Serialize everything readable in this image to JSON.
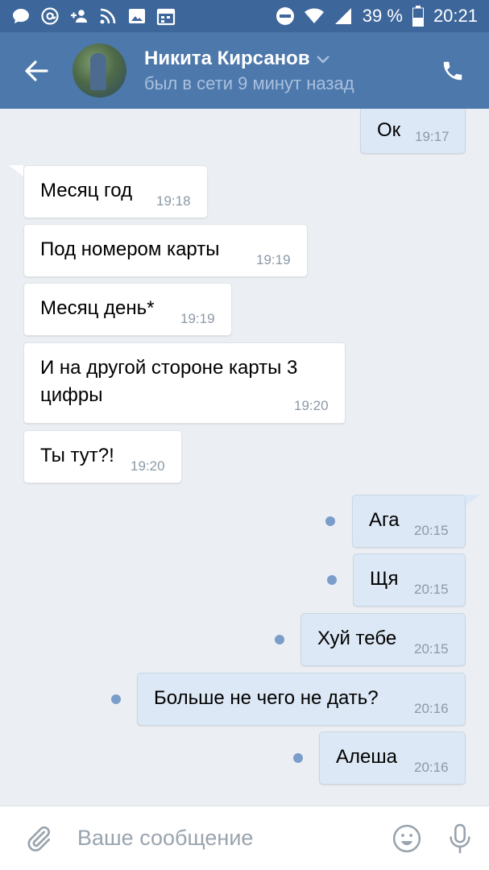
{
  "status_bar": {
    "battery": "39 %",
    "time": "20:21",
    "icons_left": [
      "message-icon",
      "at-icon",
      "add-friend-icon",
      "rss-icon",
      "image-icon",
      "calendar-icon"
    ],
    "icons_right": [
      "do-not-disturb-icon",
      "wifi-icon",
      "signal-icon",
      "battery-icon"
    ]
  },
  "header": {
    "contact_name": "Никита Кирсанов",
    "contact_status": "был в сети 9 минут назад",
    "icons": [
      "back-arrow-icon",
      "avatar",
      "chevron-down-icon",
      "phone-icon"
    ]
  },
  "messages": [
    {
      "dir": "out",
      "text": "Ок",
      "time": "19:17",
      "unread": false
    },
    {
      "dir": "in",
      "text": "Месяц год",
      "time": "19:18"
    },
    {
      "dir": "in",
      "text": "Под номером карты",
      "time": "19:19"
    },
    {
      "dir": "in",
      "text": "Месяц день*",
      "time": "19:19"
    },
    {
      "dir": "in",
      "text": "И на другой стороне карты 3 цифры",
      "time": "19:20"
    },
    {
      "dir": "in",
      "text": "Ты тут?!",
      "time": "19:20"
    },
    {
      "dir": "out",
      "text": "Ага",
      "time": "20:15",
      "unread": true
    },
    {
      "dir": "out",
      "text": "Щя",
      "time": "20:15",
      "unread": true
    },
    {
      "dir": "out",
      "text": "Хуй тебе",
      "time": "20:15",
      "unread": true
    },
    {
      "dir": "out",
      "text": "Больше не чего не дать?",
      "time": "20:16",
      "unread": true
    },
    {
      "dir": "out",
      "text": "Алеша",
      "time": "20:16",
      "unread": true
    }
  ],
  "composer": {
    "placeholder": "Ваше сообщение",
    "value": "",
    "icons": [
      "paperclip-icon",
      "emoji-icon",
      "microphone-icon"
    ]
  },
  "colors": {
    "status_bar": "#3d669a",
    "app_bar": "#4d78ab",
    "chat_background": "#ebeff3",
    "incoming_bubble": "#ffffff",
    "outgoing_bubble": "#dce8f5",
    "unread_dot": "#7b9dca"
  }
}
